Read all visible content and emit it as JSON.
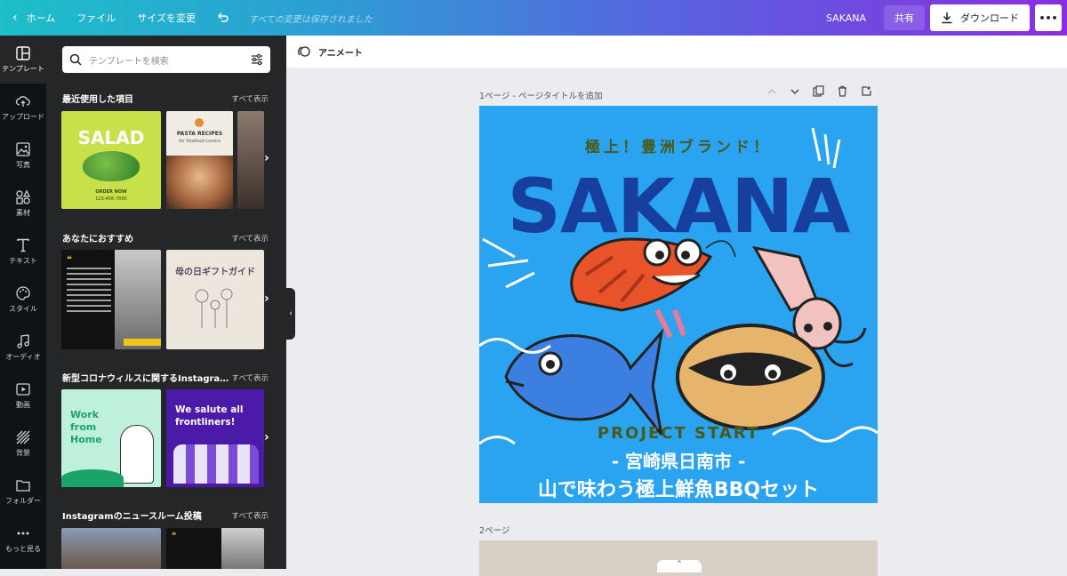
{
  "topbar": {
    "home_label": "ホーム",
    "file_label": "ファイル",
    "resize_label": "サイズを変更",
    "status": "すべての変更は保存されました",
    "doc_name": "SAKANA",
    "share_label": "共有",
    "download_label": "ダウンロード"
  },
  "leftnav": {
    "items": [
      {
        "label": "テンプレート",
        "icon": "layout-icon"
      },
      {
        "label": "アップロード",
        "icon": "upload-cloud-icon"
      },
      {
        "label": "写真",
        "icon": "photo-icon"
      },
      {
        "label": "素材",
        "icon": "shapes-icon"
      },
      {
        "label": "テキスト",
        "icon": "text-icon"
      },
      {
        "label": "スタイル",
        "icon": "palette-icon"
      },
      {
        "label": "オーディオ",
        "icon": "music-icon"
      },
      {
        "label": "動画",
        "icon": "video-icon"
      },
      {
        "label": "背景",
        "icon": "background-icon"
      },
      {
        "label": "フォルダー",
        "icon": "folder-icon"
      },
      {
        "label": "もっと見る",
        "icon": "more-icon"
      }
    ]
  },
  "panel": {
    "search_placeholder": "テンプレートを検索",
    "see_all": "すべて表示",
    "sections": [
      {
        "title": "最近使用した項目"
      },
      {
        "title": "あなたにおすすめ"
      },
      {
        "title": "新型コロナウィルスに関するInstagra…"
      },
      {
        "title": "Instagramのニュースルーム投稿"
      }
    ],
    "thumbs": {
      "salad": {
        "title": "SALAD",
        "sub": "ORDER NOW",
        "phone": "123-456-7890"
      },
      "pasta": {
        "title": "PASTA RECIPES",
        "sub": "for Seafood Lovers"
      },
      "gift": {
        "title": "母の日ギフトガイド"
      },
      "work": {
        "title": "Work from Home"
      },
      "salute": {
        "title": "We salute all frontliners!"
      }
    }
  },
  "editor": {
    "animate_label": "アニメート",
    "page1_label": "1ページ - ページタイトルを追加",
    "page2_label": "2ページ"
  },
  "design": {
    "tagline": "極上！豊洲ブランド！",
    "title": "SAKANA",
    "project": "PROJECT START",
    "location": "- 宮崎県日南市 -",
    "headline": "山で味わう極上鮮魚BBQセット"
  },
  "colors": {
    "design_bg": "#2aa3f0",
    "title_color": "#173f9e",
    "project_color": "#4a5a1a"
  }
}
